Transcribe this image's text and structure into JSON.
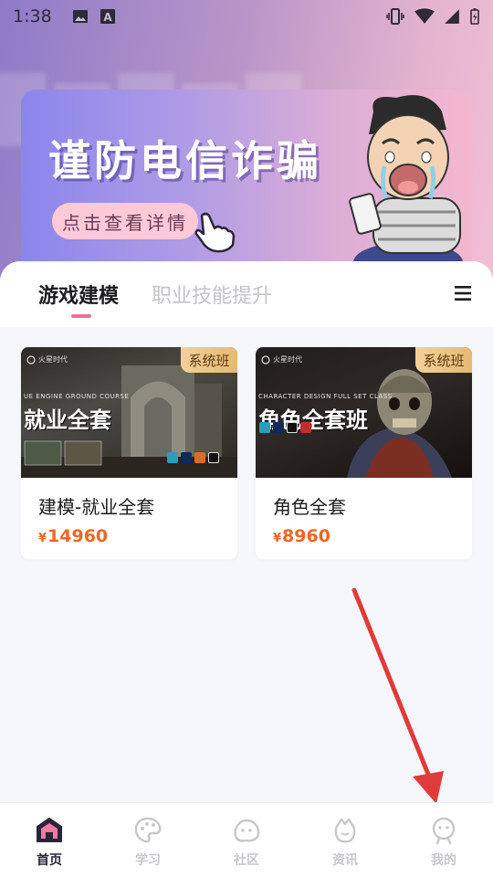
{
  "status_bar": {
    "time": "1:38",
    "left_icons": [
      "image-icon",
      "text-box-icon"
    ],
    "right_icons": [
      "vibrate-icon",
      "wifi-icon",
      "signal-icon",
      "battery-icon"
    ]
  },
  "banner": {
    "title": "谨防电信诈骗",
    "button_label": "点击查看详情",
    "colors": {
      "start": "#8b86ec",
      "end": "#f4b7cf",
      "pill": "#ffc9d8"
    }
  },
  "tabs": {
    "items": [
      {
        "label": "游戏建模",
        "active": true
      },
      {
        "label": "职业技能提升",
        "active": false
      }
    ],
    "accent": "#ef6c9a"
  },
  "courses": [
    {
      "badge": "系统班",
      "thumb_logo": "火星时代",
      "thumb_subtitle": "UE ENGINE GROUND COURSE",
      "thumb_title": "就业全套",
      "title": "建模-就业全套",
      "currency": "¥",
      "price": "14960"
    },
    {
      "badge": "系统班",
      "thumb_logo": "火星时代",
      "thumb_subtitle": "CHARACTER DESIGN FULL SET CLASS",
      "thumb_title": "角色全套班",
      "title": "角色全套",
      "currency": "¥",
      "price": "8960"
    }
  ],
  "price_color": "#f06523",
  "bottom_nav": [
    {
      "label": "首页",
      "icon": "home-icon",
      "active": true
    },
    {
      "label": "学习",
      "icon": "palette-icon",
      "active": false
    },
    {
      "label": "社区",
      "icon": "community-icon",
      "active": false
    },
    {
      "label": "资讯",
      "icon": "news-icon",
      "active": false
    },
    {
      "label": "我的",
      "icon": "profile-icon",
      "active": false
    }
  ],
  "annotation_color": "#e03a3a"
}
